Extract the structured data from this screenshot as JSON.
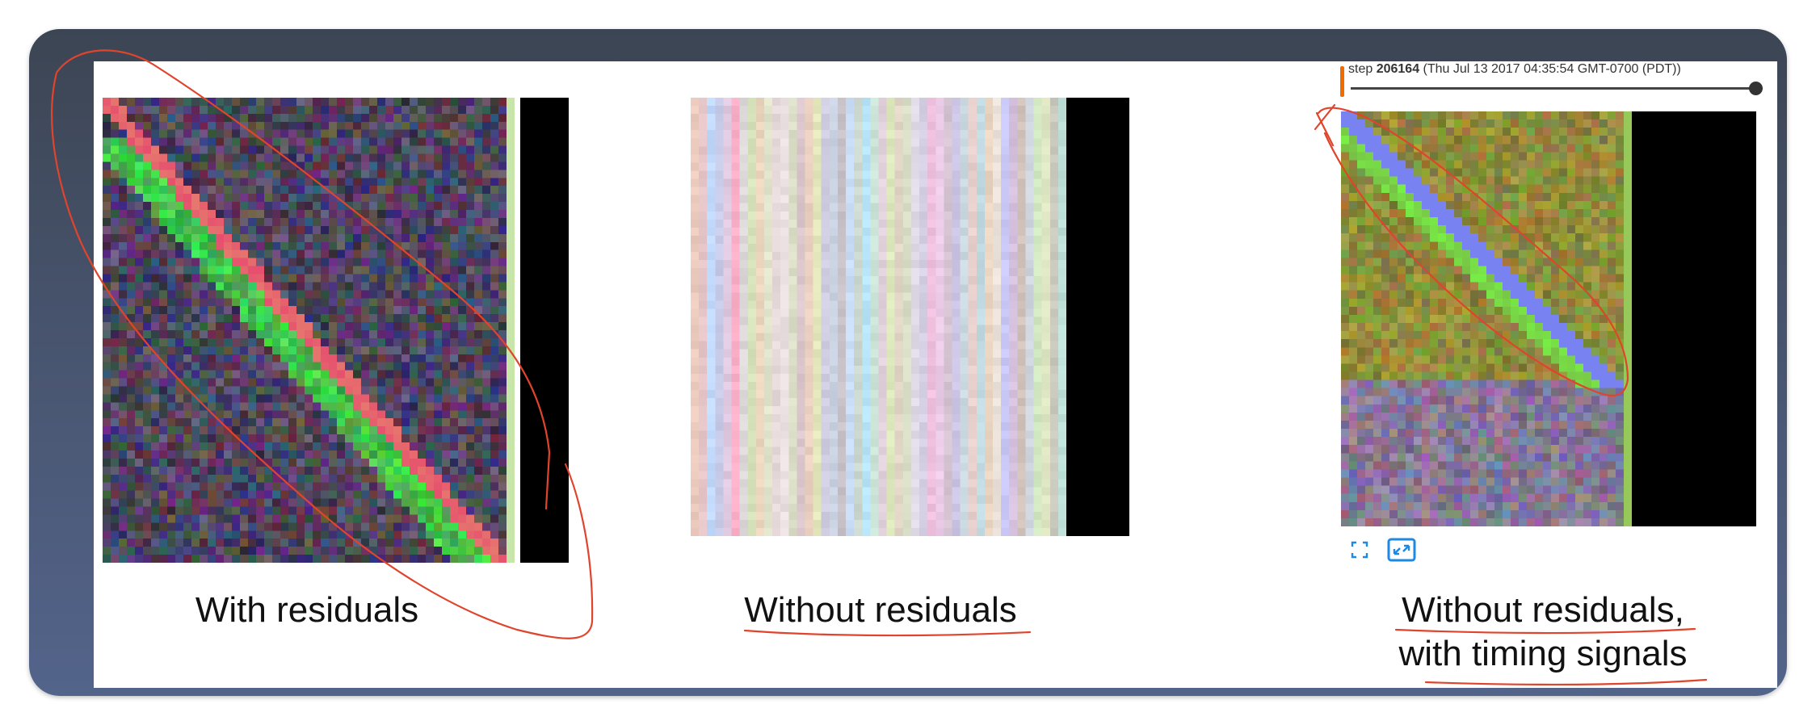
{
  "panels": [
    {
      "caption": "With residuals",
      "pattern": "diagonal"
    },
    {
      "caption": "Without residuals",
      "pattern": "stripes"
    },
    {
      "caption_line1": "Without residuals,",
      "caption_line2": "with timing signals",
      "pattern": "diagonal-soft"
    }
  ],
  "tensorboard": {
    "step_label": "step",
    "step_value": "206164",
    "timestamp": "(Thu Jul 13 2017 04:35:54 GMT-0700 (PDT))",
    "icons": [
      "fullscreen-icon",
      "fit-image-icon"
    ]
  },
  "annotation_color": "#e0442c"
}
